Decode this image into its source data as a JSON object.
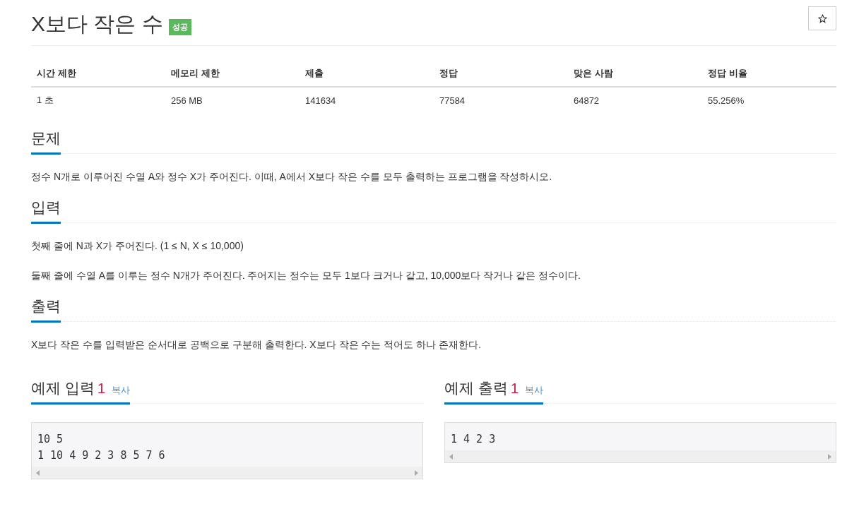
{
  "title": "X보다 작은 수",
  "badge": "성공",
  "stats": {
    "columns": [
      "시간 제한",
      "메모리 제한",
      "제출",
      "정답",
      "맞은 사람",
      "정답 비율"
    ],
    "values": [
      "1 초",
      "256 MB",
      "141634",
      "77584",
      "64872",
      "55.256%"
    ]
  },
  "sections": [
    {
      "heading": "문제",
      "paragraphs": [
        "정수 N개로 이루어진 수열 A와 정수 X가 주어진다. 이때, A에서 X보다 작은 수를 모두 출력하는 프로그램을 작성하시오."
      ]
    },
    {
      "heading": "입력",
      "paragraphs": [
        "첫째 줄에 N과 X가 주어진다. (1 ≤ N, X ≤ 10,000)",
        "둘째 줄에 수열 A를 이루는 정수 N개가 주어진다. 주어지는 정수는 모두 1보다 크거나 같고, 10,000보다 작거나 같은 정수이다."
      ]
    },
    {
      "heading": "출력",
      "paragraphs": [
        "X보다 작은 수를 입력받은 순서대로 공백으로 구분해 출력한다. X보다 작은 수는 적어도 하나 존재한다."
      ]
    }
  ],
  "samples": [
    {
      "heading": "예제 입력",
      "number": "1",
      "copy": "복사",
      "lines": [
        "10 5",
        "1 10 4 9 2 3 8 5 7 6"
      ]
    },
    {
      "heading": "예제 출력",
      "number": "1",
      "copy": "복사",
      "lines": [
        "1 4 2 3"
      ]
    }
  ]
}
